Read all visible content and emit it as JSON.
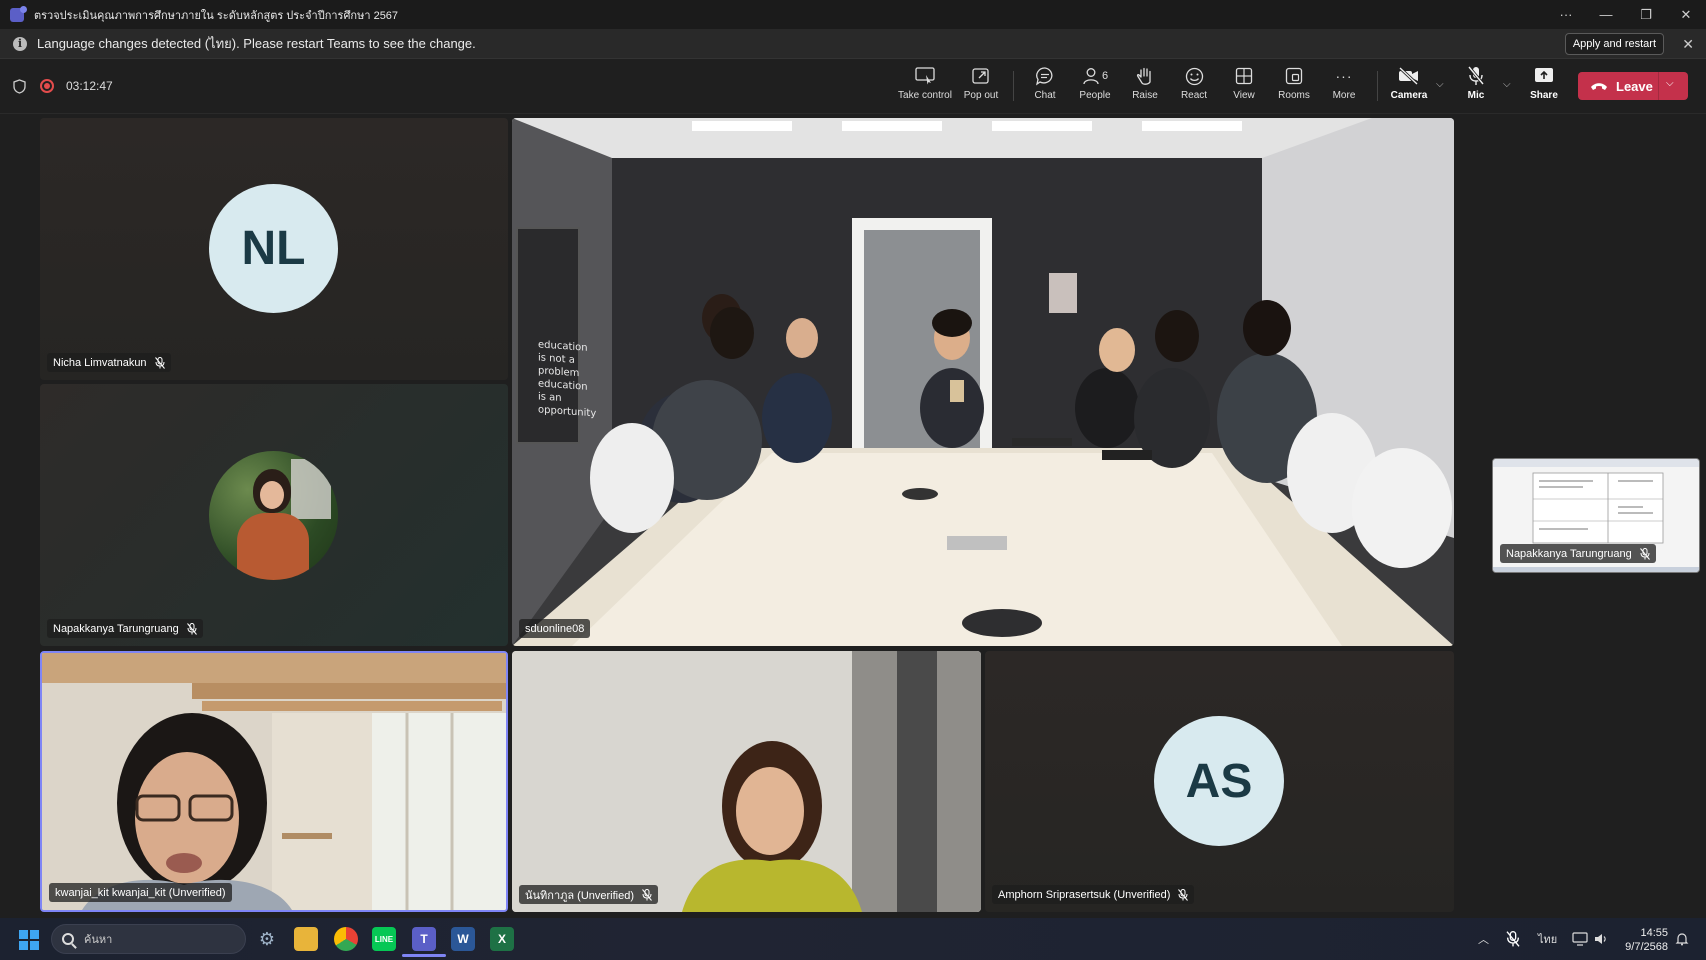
{
  "window": {
    "title": "ตรวจประเมินคุณภาพการศึกษาภายใน ระดับหลักสูตร ประจำปีการศึกษา 2567",
    "controls": [
      "···",
      "—",
      "❐",
      "✕"
    ]
  },
  "banner": {
    "message": "Language changes detected (ไทย). Please restart Teams to see the change.",
    "apply_label": "Apply and restart"
  },
  "meeting": {
    "timer": "03:12:47",
    "toolbar": {
      "take_control": "Take control",
      "pop_out": "Pop out",
      "chat": "Chat",
      "people": "People",
      "people_count": "6",
      "raise": "Raise",
      "react": "React",
      "view": "View",
      "rooms": "Rooms",
      "more": "More",
      "camera": "Camera",
      "mic": "Mic",
      "share": "Share",
      "leave": "Leave"
    }
  },
  "participants": [
    {
      "initials": "NL",
      "name": "Nicha Limvatnakun"
    },
    {
      "name": "Napakkanya Tarungruang"
    },
    {
      "name": "sduonline08"
    },
    {
      "name": "kwanjai_kit kwanjai_kit (Unverified)"
    },
    {
      "name": "นันทิกาภูล (Unverified)"
    },
    {
      "initials": "AS",
      "name": "Amphorn Sriprasertsuk (Unverified)"
    }
  ],
  "room_poster": [
    "education",
    "is not a",
    "problem",
    "education",
    "is an",
    "opportunity"
  ],
  "screen_share": {
    "name": "Napakkanya Tarungruang"
  },
  "taskbar": {
    "search_placeholder": "ค้นหา",
    "language": "ไทย",
    "time": "14:55",
    "date": "9/7/2568"
  },
  "colors": {
    "leave": "#c4314b",
    "record": "#e34c4c",
    "active_speaker_border": "#7f85f5",
    "avatar_bg": "#d8eaef"
  }
}
